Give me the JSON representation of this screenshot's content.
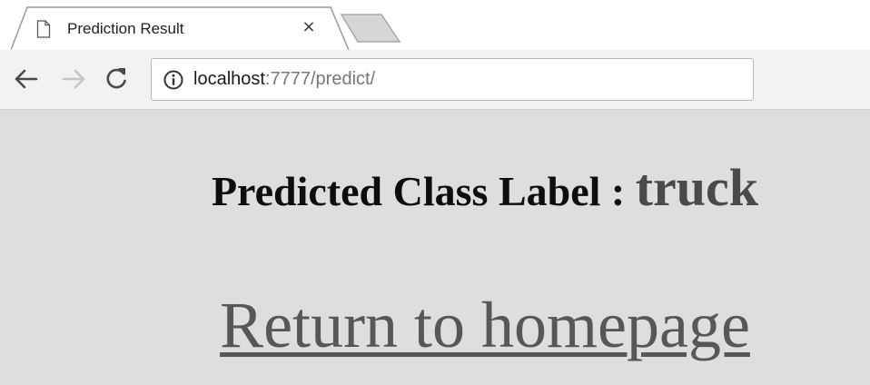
{
  "browser": {
    "tab": {
      "title": "Prediction Result",
      "close_glyph": "×"
    },
    "toolbar": {
      "back_icon": "back-arrow-icon",
      "forward_icon": "forward-arrow-icon",
      "reload_icon": "reload-icon",
      "security_icon": "info-icon"
    },
    "address_bar": {
      "host": "localhost",
      "rest": ":7777/predict/"
    }
  },
  "page": {
    "heading_label": "Predicted Class Label : ",
    "predicted_class": "truck",
    "home_link": "Return to homepage"
  },
  "colors": {
    "page_background": "#dedede",
    "heading_text": "#0d0d0d",
    "predicted_class_text": "#4a4a4a",
    "link_text": "#575757"
  }
}
